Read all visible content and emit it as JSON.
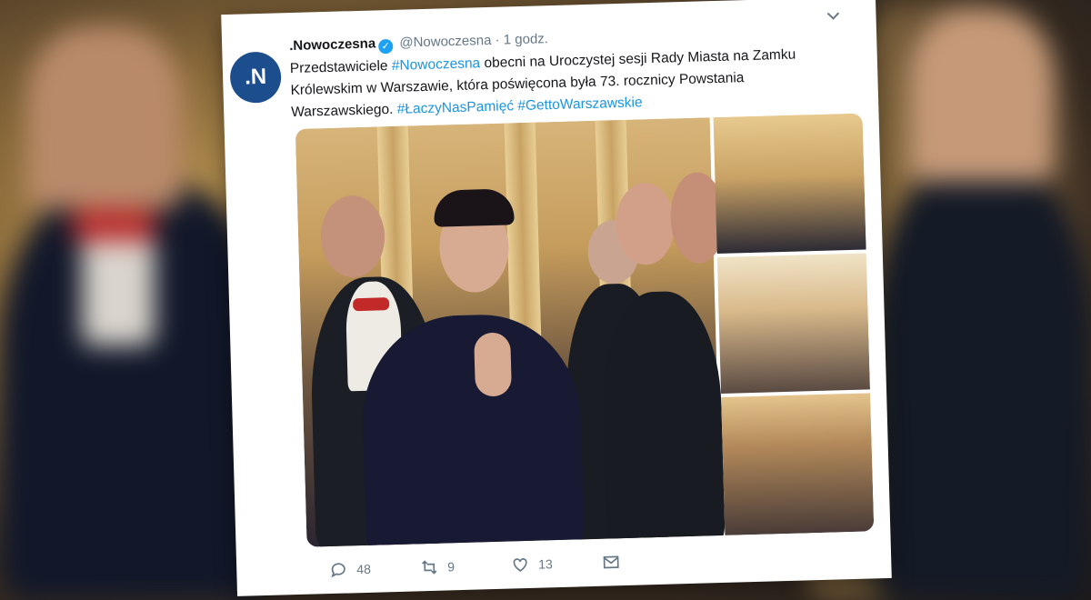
{
  "tweet": {
    "display_name": ".Nowoczesna",
    "handle": "@Nowoczesna",
    "separator": "·",
    "time": "1 godz.",
    "avatar_text": ".N",
    "text_before_tag": "Przedstawiciele ",
    "hashtag_1": "#Nowoczesna",
    "text_after_tag": " obecni na Uroczystej sesji Rady Miasta na Zamku Królewskim w Warszawie, która poświęcona była 73. rocznicy Powstania Warszawskiego. ",
    "hashtag_2": "#ŁaczyNasPamięć",
    "hashtag_3": "#GettoWarszawskie"
  },
  "actions": {
    "reply_count": "48",
    "retweet_count": "9",
    "like_count": "13"
  },
  "icons": [
    "verified-icon",
    "chevron-down-icon",
    "reply-icon",
    "retweet-icon",
    "like-icon",
    "message-icon"
  ],
  "colors": {
    "link": "#1b95e0",
    "avatar_bg": "#1c4e8d",
    "verified": "#1da1f2"
  }
}
